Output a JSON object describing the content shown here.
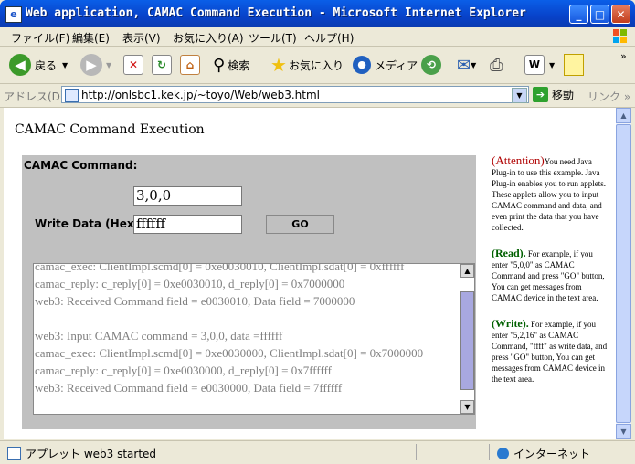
{
  "window": {
    "title": "Web application, CAMAC Command Execution - Microsoft Internet Explorer",
    "minimize": "_",
    "maximize": "□",
    "close": "✕"
  },
  "menu": [
    "ファイル(F)",
    "編集(E)",
    "表示(V)",
    "お気に入り(A)",
    "ツール(T)",
    "ヘルプ(H)"
  ],
  "toolbar": {
    "back_label": "戻る",
    "search_label": "検索",
    "favorites_label": "お気に入り",
    "media_label": "メディア"
  },
  "address": {
    "label": "アドレス(D)",
    "url": "http://onlsbc1.kek.jp/~toyo/Web/web3.html",
    "go_label": "移動",
    "links_label": "リンク"
  },
  "page": {
    "title": "CAMAC Command Execution"
  },
  "applet": {
    "command_label": "CAMAC Command:",
    "command_value": "3,0,0",
    "write_label": "Write Data (Hex) :",
    "write_value": "ffffff",
    "go_button": "GO",
    "log_lines": [
      "camac_exec: ClientImpl.scmd[0] = 0xe0030010, ClientImpl.sdat[0] = 0xffffff",
      "camac_reply: c_reply[0] = 0xe0030010, d_reply[0] = 0x7000000",
      "web3:  Received Command field = e0030010,    Data field = 7000000",
      "",
      "web3:  Input CAMAC command = 3,0,0,    data =ffffff",
      "camac_exec: ClientImpl.scmd[0] = 0xe0030000, ClientImpl.sdat[0] = 0x7000000",
      "camac_reply: c_reply[0] = 0xe0030000, d_reply[0] = 0x7ffffff",
      "web3:  Received Command field = e0030000,    Data field = 7ffffff"
    ]
  },
  "sidebar": {
    "attention_head": "(Attention)",
    "attention_text": "You need Java Plug-in to use this example. Java Plug-in enables you to run applets. These applets allow you to input CAMAC command and data, and even print the data that you have collected.",
    "read_head": "(Read).",
    "read_text": "For example, if you enter \"5,0,0\" as CAMAC Command and press \"GO\" button, You can get messages from CAMAC device in the text area.",
    "write_head": "(Write).",
    "write_text": "For example, if you enter \"5,2,16\" as CAMAC Command, \"ffff\" as write data, and press \"GO\" button, You can get messages from CAMAC device in the text area."
  },
  "status": {
    "left_text": "アプレット web3 started",
    "zone_text": "インターネット"
  },
  "colors": {
    "titlebar": "#0842c9",
    "applet_bg": "#c0c0c0",
    "attention": "#b00000",
    "green_head": "#006000"
  }
}
